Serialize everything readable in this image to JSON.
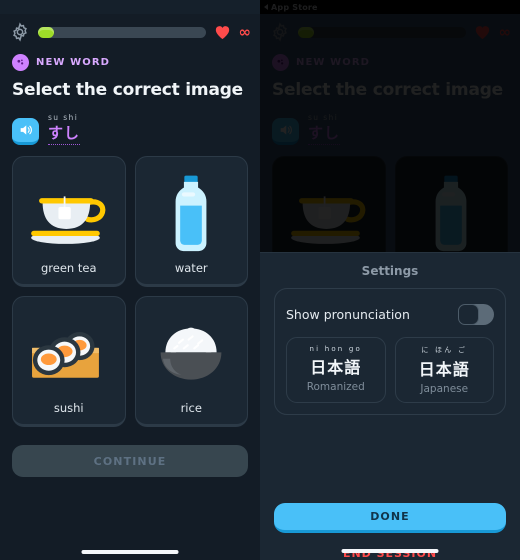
{
  "left_screen": {
    "topbar": {
      "gear_icon": "gear-icon",
      "progress_percent": 8,
      "heart_icon": "heart-icon",
      "hearts_value": "∞"
    },
    "chip": {
      "icon": "new-word-badge-icon",
      "label": "NEW WORD"
    },
    "prompt": "Select the correct image",
    "word": {
      "speaker_icon": "speaker-icon",
      "romaji": "su shi",
      "text": "すし"
    },
    "choices": [
      {
        "label": "green tea",
        "art": "teacup-icon"
      },
      {
        "label": "water",
        "art": "water-bottle-icon"
      },
      {
        "label": "sushi",
        "art": "sushi-icon"
      },
      {
        "label": "rice",
        "art": "rice-bowl-icon"
      }
    ],
    "continue_label": "CONTINUE"
  },
  "right_screen": {
    "statusbar": {
      "back_label": "App Store"
    },
    "settings": {
      "title": "Settings",
      "pronunciation": {
        "label": "Show pronunciation",
        "toggle_state": "off"
      },
      "script_options": [
        {
          "ruby": "ni hon go",
          "word": "日本語",
          "caption": "Romanized"
        },
        {
          "ruby": "に ほん ご",
          "word": "日本語",
          "caption": "Japanese"
        }
      ],
      "done_label": "DONE",
      "end_session_label": "END SESSION"
    }
  },
  "colors": {
    "background": "#131c26",
    "card": "#1b2733",
    "accent_blue": "#49c0f8",
    "accent_purple": "#ce82ff",
    "progress_green": "#9ddc28",
    "danger_red": "#ff4b4b"
  }
}
